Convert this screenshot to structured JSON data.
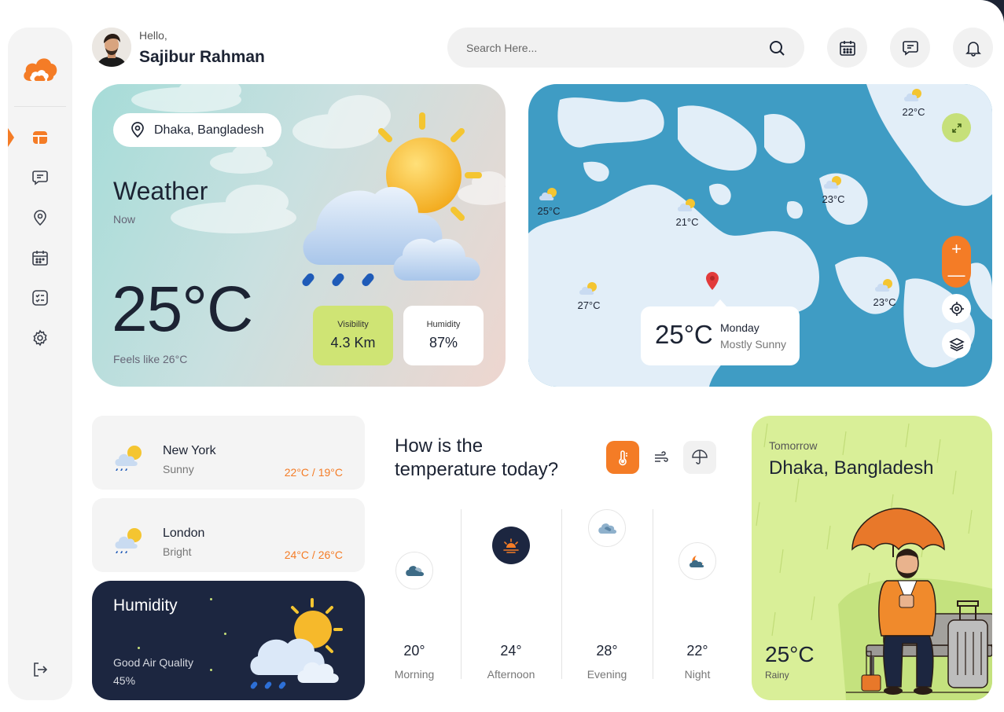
{
  "header": {
    "greeting": "Hello,",
    "user_name": "Sajibur Rahman",
    "search_placeholder": "Search Here...",
    "icons": [
      "calendar-icon",
      "chat-icon",
      "bell-icon"
    ]
  },
  "sidebar": {
    "items": [
      "dashboard-icon",
      "chat-icon",
      "location-icon",
      "calendar-icon",
      "checklist-icon",
      "settings-icon"
    ],
    "active": "dashboard-icon",
    "footer": "logout-icon"
  },
  "weather": {
    "location": "Dhaka, Bangladesh",
    "title": "Weather",
    "subtitle": "Now",
    "temperature": "25°C",
    "feels_like": "Feels like 26°C",
    "visibility_label": "Visibility",
    "visibility_value": "4.3 Km",
    "humidity_label": "Humidity",
    "humidity_value": "87%"
  },
  "map": {
    "markers": [
      "22°C",
      "25°C",
      "21°C",
      "23°C",
      "27°C",
      "23°C"
    ],
    "popup": {
      "temperature": "25°C",
      "day": "Monday",
      "condition": "Mostly Sunny"
    },
    "zoom_in": "+",
    "zoom_out": "—"
  },
  "cities": [
    {
      "name": "New York",
      "condition": "Sunny",
      "range": "22°C / 19°C"
    },
    {
      "name": "London",
      "condition": "Bright",
      "range": "24°C / 26°C"
    }
  ],
  "humidity_card": {
    "title": "Humidity",
    "quality": "Good Air Quality",
    "value": "45%"
  },
  "temperature_today": {
    "title_line1": "How is the",
    "title_line2": "temperature today?",
    "periods": [
      {
        "value": "20°",
        "label": "Morning"
      },
      {
        "value": "24°",
        "label": "Afternoon"
      },
      {
        "value": "28°",
        "label": "Evening"
      },
      {
        "value": "22°",
        "label": "Night"
      }
    ]
  },
  "tomorrow": {
    "label": "Tomorrow",
    "location": "Dhaka, Bangladesh",
    "temperature": "25°C",
    "condition": "Rainy"
  },
  "colors": {
    "accent": "#f47c26",
    "lime": "#c6e07a",
    "navy": "#1c2640",
    "map_water": "#3f9cc4",
    "map_land": "#e2eef8"
  }
}
